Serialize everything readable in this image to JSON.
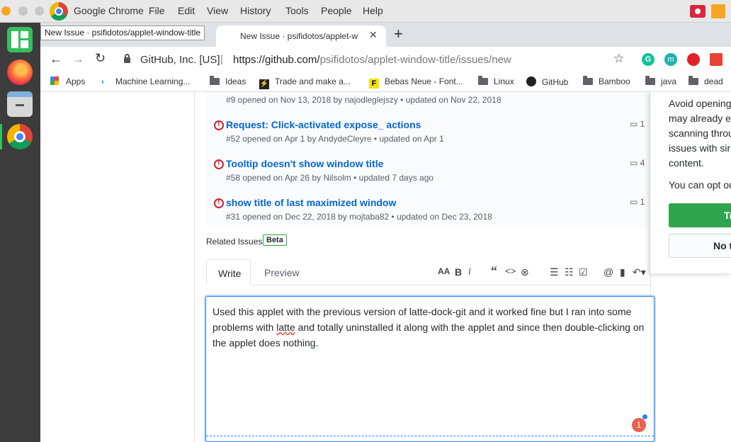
{
  "menubar": {
    "app_name": "Google Chrome",
    "items": [
      "File",
      "Edit",
      "View",
      "History",
      "Tools",
      "People",
      "Help"
    ]
  },
  "tooltip": "New Issue · psifidotos/applet-window-title",
  "tab": {
    "title": "New Issue · psifidotos/applet-w"
  },
  "toolbar": {
    "site_identity": "GitHub, Inc. [US]",
    "url_prefix": "https://github.com/",
    "url_path": "psifidotos/applet-window-title/issues/new"
  },
  "bookmarks": [
    "Apps",
    "Machine Learning...",
    "Ideas",
    "Trade and make a...",
    "Bebas Neue - Font...",
    "Linux",
    "GitHub",
    "Bamboo",
    "java",
    "dead"
  ],
  "issues": [
    {
      "title": "",
      "meta": "#9 opened on Nov 13, 2018 by najodleglejszy • updated on Nov 22, 2018",
      "comments": ""
    },
    {
      "title": "Request: Click-activated expose_ actions",
      "meta": "#52 opened on Apr 1 by AndydeCleyre • updated on Apr 1",
      "comments": "1"
    },
    {
      "title": "Tooltip doesn't show window title",
      "meta": "#58 opened on Apr 26 by Nilsolm • updated 7 days ago",
      "comments": "4"
    },
    {
      "title": "show title of last maximized window",
      "meta": "#31 opened on Dec 22, 2018 by mojtaba82 • updated on Dec 23, 2018",
      "comments": "1"
    }
  ],
  "related": {
    "label": "Related Issues",
    "badge": "Beta"
  },
  "editor": {
    "tab_write": "Write",
    "tab_preview": "Preview",
    "body_line1": "Used this applet with the previous version of latte-dock-git and it worked fine but I ran into some",
    "body_line2_a": "problems with ",
    "body_line2_b": "latte",
    "body_line2_c": " and totally uninstalled it along with the applet and since then double-clicking on",
    "body_line3": "the applet does nothing.",
    "badge": "1"
  },
  "popup": {
    "lines": [
      "Avoid opening",
      "may already ex",
      "scanning throu",
      "issues with sir",
      "content."
    ],
    "opt_out": "You can opt ou",
    "primary_btn": "Tr",
    "secondary_btn": "No t"
  },
  "colors": {
    "accent_link": "#0366d6",
    "issue_red": "#cb2431",
    "green_btn": "#2ea44f"
  }
}
